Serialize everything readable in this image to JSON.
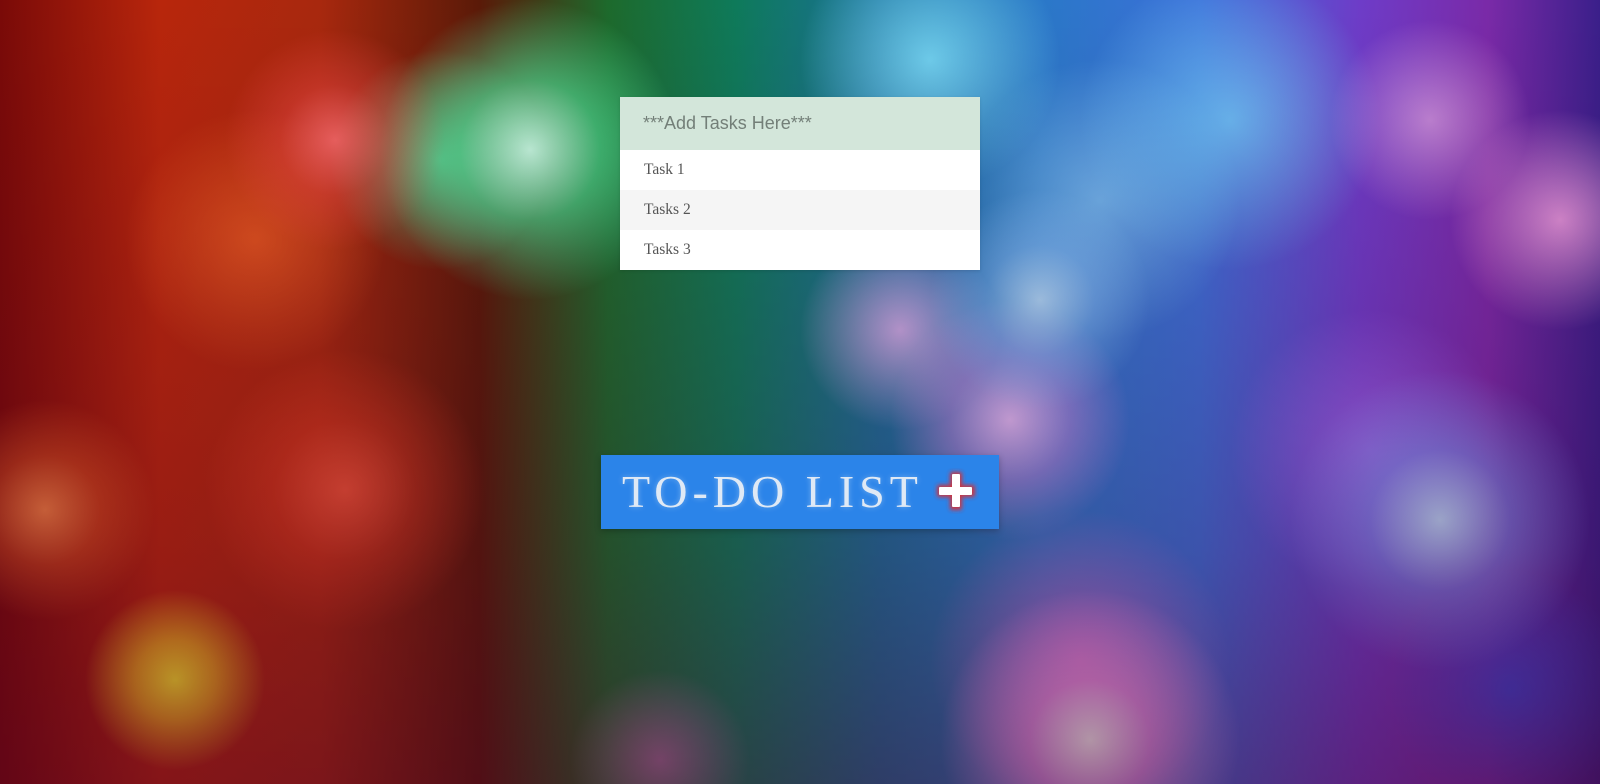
{
  "task_input": {
    "placeholder": "***Add Tasks Here***"
  },
  "tasks": [
    {
      "label": "Task 1"
    },
    {
      "label": "Tasks 2"
    },
    {
      "label": "Tasks 3"
    }
  ],
  "header": {
    "title": "TO-DO LIST",
    "add_icon": "plus-icon",
    "add_icon_color": "#e02a2a"
  },
  "colors": {
    "title_bar": "#2b84e9",
    "input_background": "#d3e6da"
  }
}
